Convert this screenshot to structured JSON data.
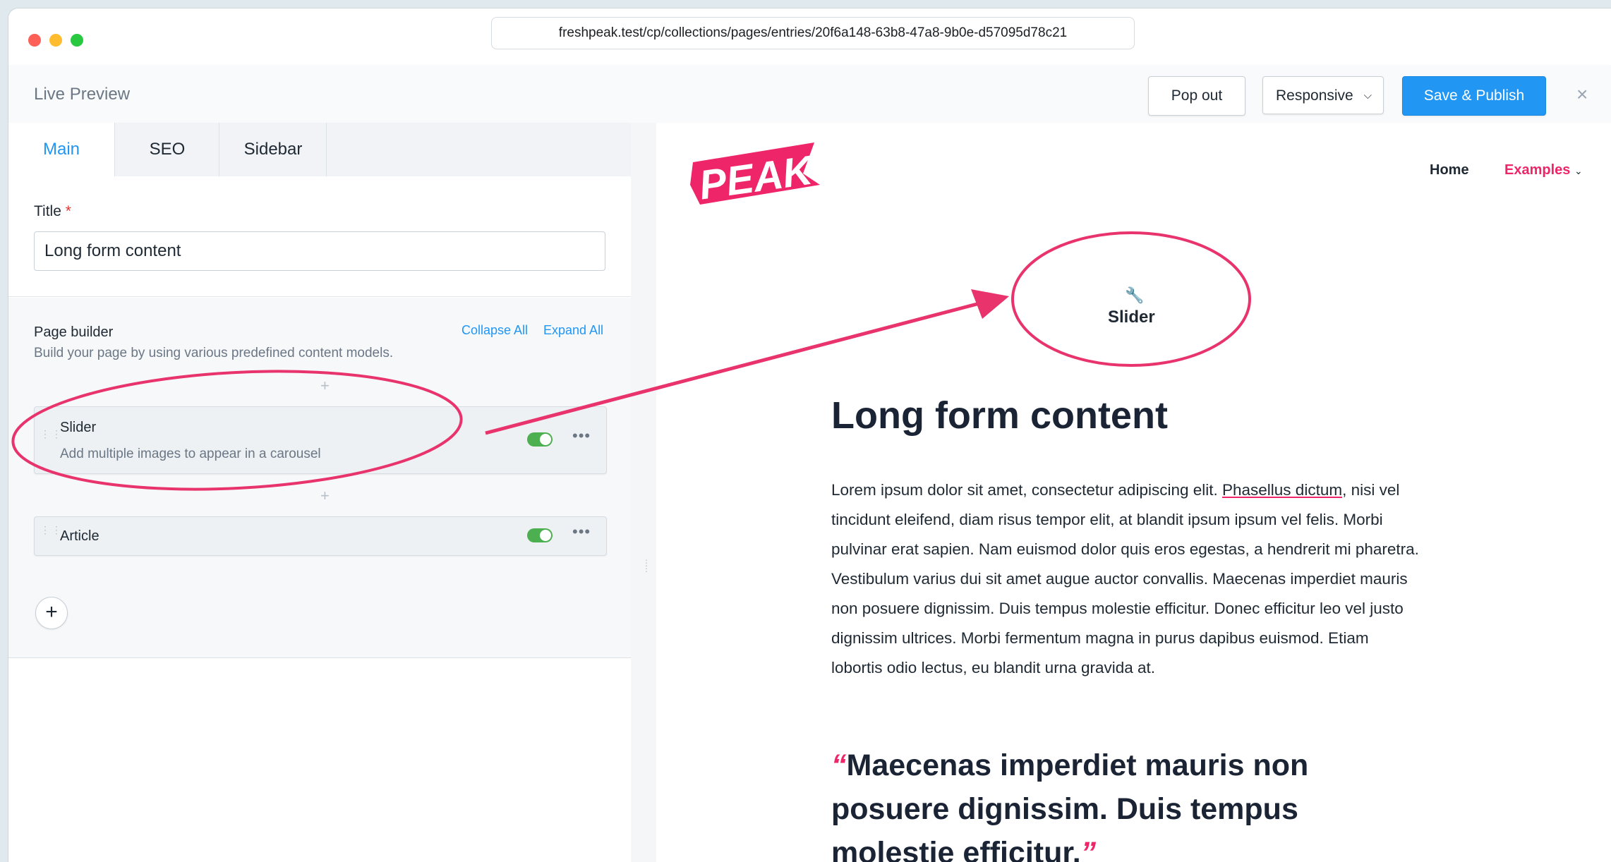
{
  "browser": {
    "url": "freshpeak.test/cp/collections/pages/entries/20f6a148-63b8-47a8-9b0e-d57095d78c21"
  },
  "header": {
    "title": "Live Preview",
    "popout_label": "Pop out",
    "responsive_label": "Responsive",
    "publish_label": "Save & Publish",
    "close_glyph": "×"
  },
  "tabs": [
    {
      "label": "Main"
    },
    {
      "label": "SEO"
    },
    {
      "label": "Sidebar"
    }
  ],
  "title_field": {
    "label": "Title",
    "required_mark": "*",
    "value": "Long form content"
  },
  "page_builder": {
    "label": "Page builder",
    "description": "Build your page by using various predefined content models.",
    "collapse_all": "Collapse All",
    "expand_all": "Expand All",
    "sets": [
      {
        "name": "Slider",
        "description": "Add multiple images to appear in a carousel",
        "enabled": true
      },
      {
        "name": "Article",
        "description": "",
        "enabled": true
      }
    ],
    "add_glyph": "+"
  },
  "preview": {
    "logo_text": "PEAK",
    "nav": {
      "home": "Home",
      "examples": "Examples"
    },
    "slider_placeholder": "Slider",
    "heading": "Long form content",
    "paragraph_before_link": "Lorem ipsum dolor sit amet, consectetur adipiscing elit. ",
    "paragraph_link": "Phasellus dictum",
    "paragraph_after_link": ", nisi vel tincidunt eleifend, diam risus tempor elit, at blandit ipsum ipsum vel felis. Morbi pulvinar erat sapien. Nam euismod dolor quis eros egestas, a hendrerit mi pharetra. Vestibulum varius dui sit amet augue auctor convallis. Maecenas imperdiet mauris non posuere dignissim. Duis tempus molestie efficitur. Donec efficitur leo vel justo dignissim ultrices. Morbi fermentum magna in purus dapibus euismod. Etiam lobortis odio lectus, eu blandit urna gravida at.",
    "quote_open": "“",
    "quote": "Maecenas imperdiet mauris non posuere dignissim. Duis tempus molestie efficitur.",
    "quote_close": "”"
  },
  "colors": {
    "accent_blue": "#2196f3",
    "brand_pink": "#ee2569",
    "toggle_green": "#4caf50",
    "annotation": "#e8336d"
  }
}
